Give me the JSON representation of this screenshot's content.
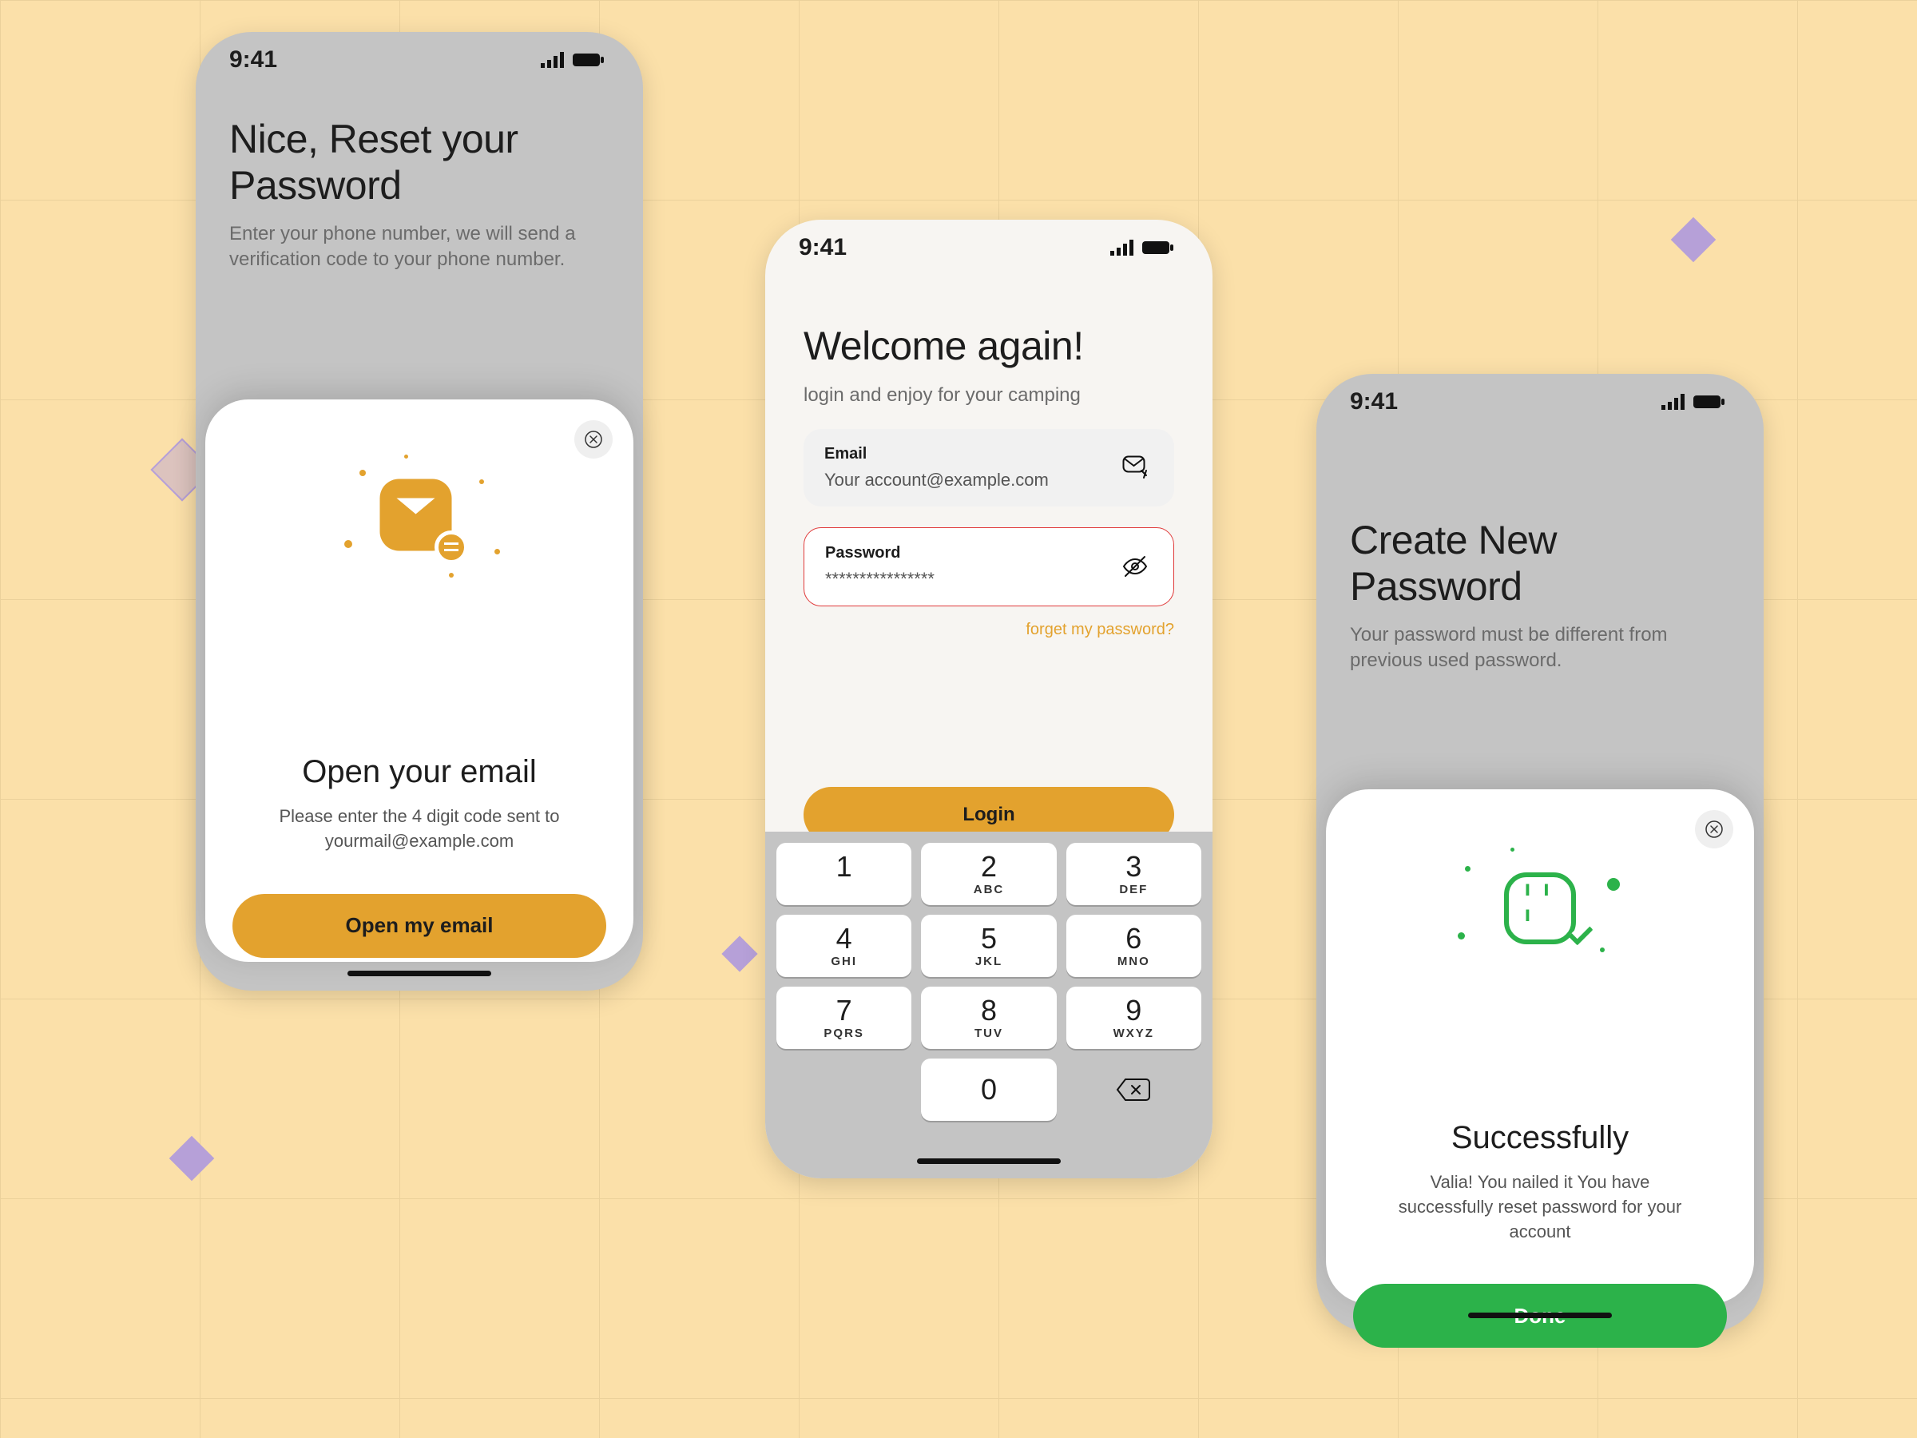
{
  "status_time": "9:41",
  "screen1": {
    "title": "Nice, Reset your Password",
    "subtitle": "Enter your phone number, we will send a verification code to your phone number.",
    "sheet": {
      "heading": "Open your email",
      "description": "Please enter the 4 digit code sent to yourmail@example.com",
      "button": "Open my email"
    }
  },
  "screen2": {
    "title": "Welcome again!",
    "subtitle": "login and enjoy for your camping",
    "email_label": "Email",
    "email_value": "Your account@example.com",
    "password_label": "Password",
    "password_value": "****************",
    "forgot": "forget my password?",
    "login_button": "Login",
    "keypad": [
      {
        "n": "1",
        "l": ""
      },
      {
        "n": "2",
        "l": "ABC"
      },
      {
        "n": "3",
        "l": "DEF"
      },
      {
        "n": "4",
        "l": "GHI"
      },
      {
        "n": "5",
        "l": "JKL"
      },
      {
        "n": "6",
        "l": "MNO"
      },
      {
        "n": "7",
        "l": "PQRS"
      },
      {
        "n": "8",
        "l": "TUV"
      },
      {
        "n": "9",
        "l": "WXYZ"
      },
      {
        "n": "0",
        "l": ""
      }
    ]
  },
  "screen3": {
    "title": "Create New Password",
    "subtitle": "Your password must be different from previous used password.",
    "sheet": {
      "heading": "Successfully",
      "description": "Valia! You nailed it You have successfully reset password for your account",
      "button": "Done"
    }
  },
  "colors": {
    "accent_orange": "#e3a22e",
    "accent_green": "#2cb24a",
    "error_red": "#e03a3a"
  }
}
